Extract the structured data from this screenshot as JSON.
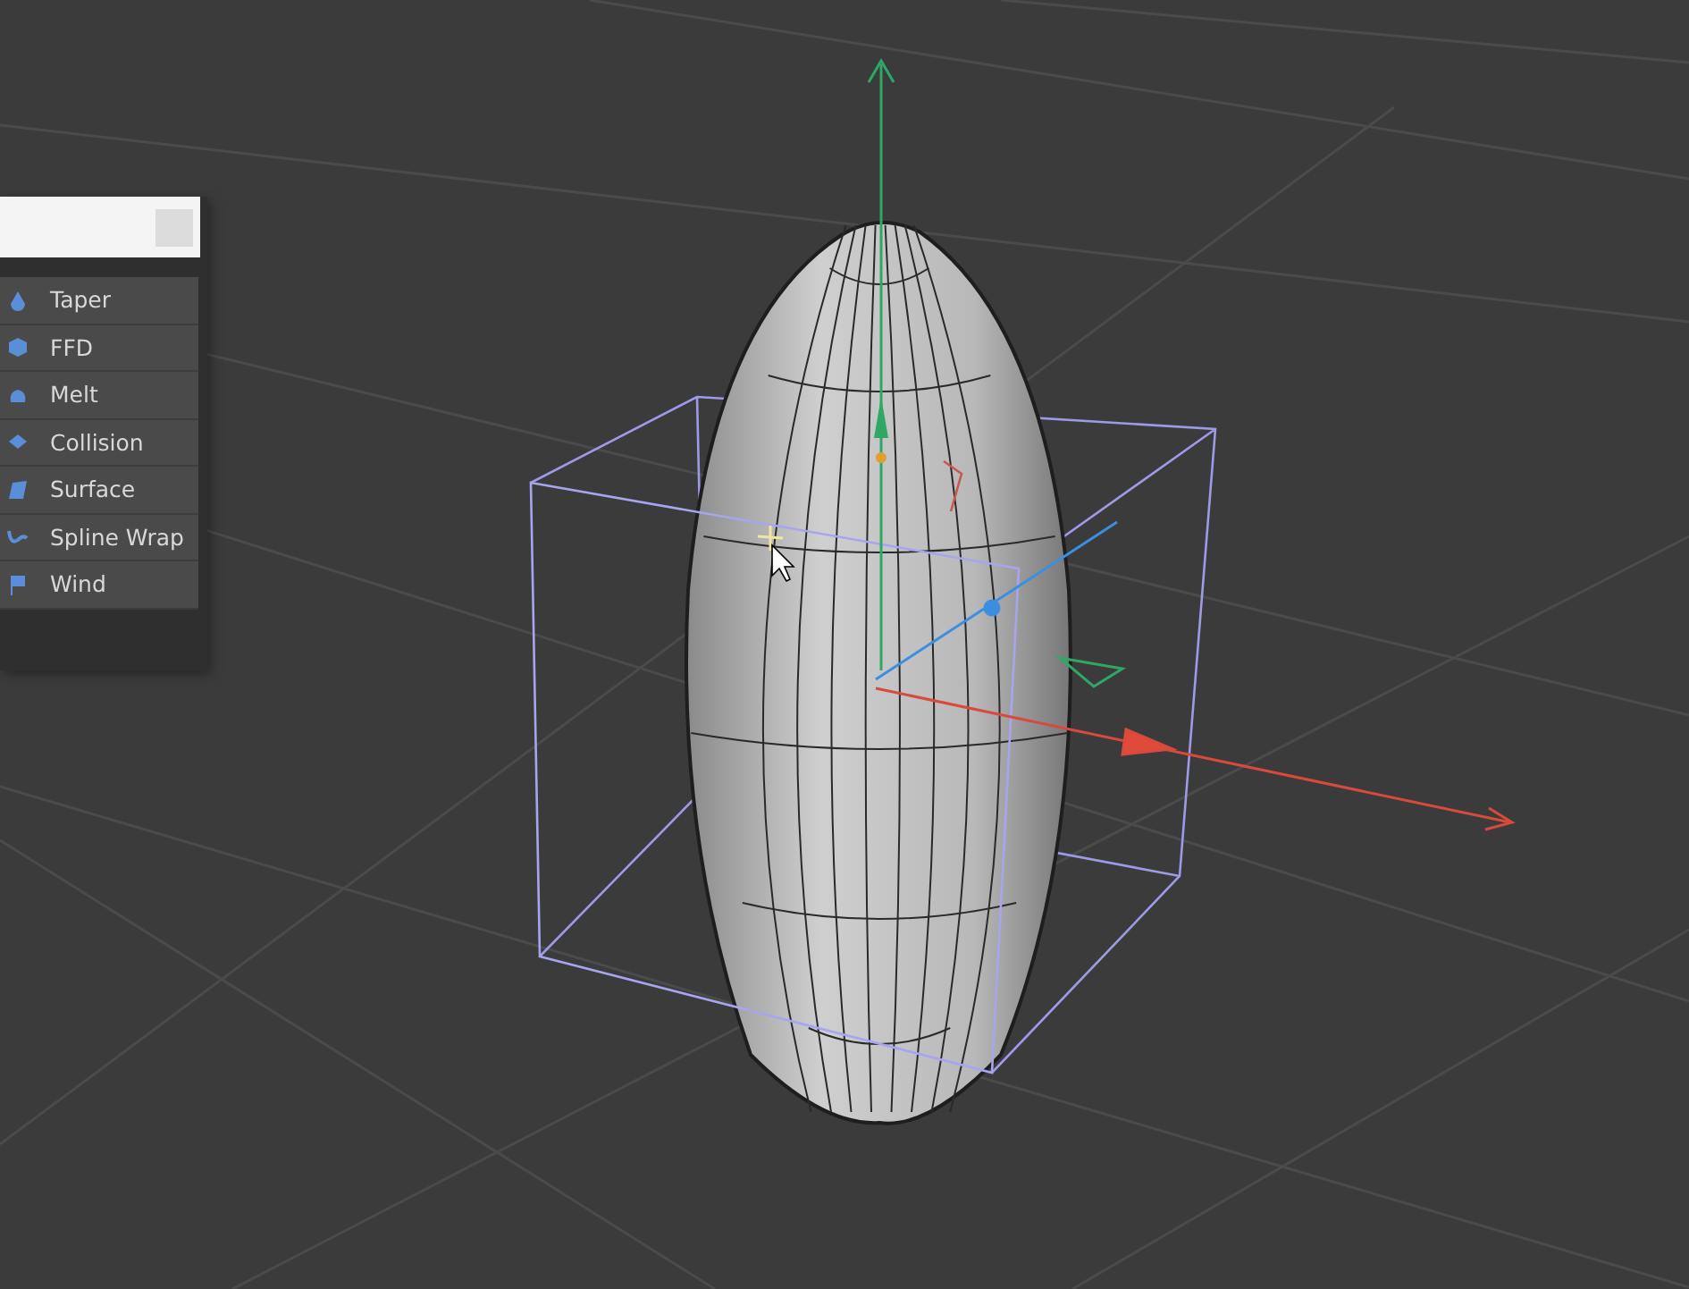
{
  "menu": {
    "items": [
      {
        "label": "Taper"
      },
      {
        "label": "FFD"
      },
      {
        "label": "Melt"
      },
      {
        "label": "Collision"
      },
      {
        "label": "Surface"
      },
      {
        "label": "Spline Wrap"
      },
      {
        "label": "Wind"
      }
    ]
  }
}
